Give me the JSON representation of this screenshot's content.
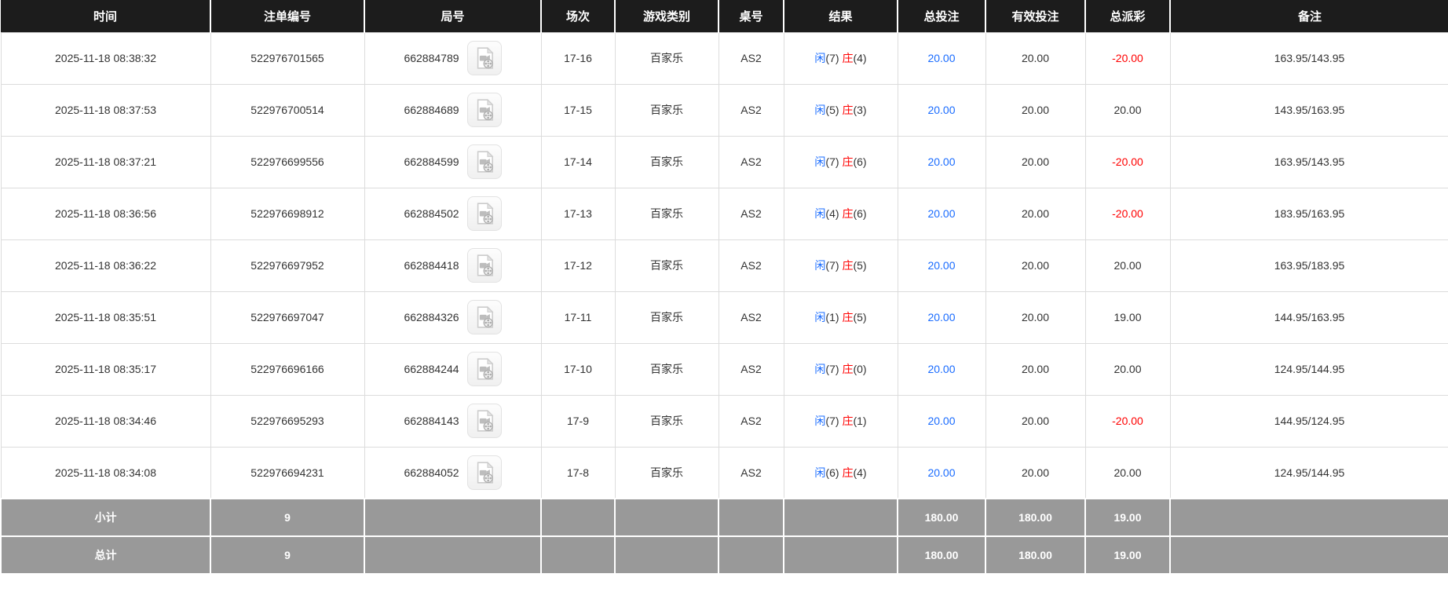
{
  "colors": {
    "header_bg": "#1c1c1c",
    "accent_blue": "#1a6cff",
    "negative_red": "#ff0000",
    "summary_bg": "#999999",
    "grid_line": "#dcdcdc"
  },
  "icons": {
    "video_replay": "video-replay-icon"
  },
  "table": {
    "columns": [
      "时间",
      "注单编号",
      "局号",
      "场次",
      "游戏类别",
      "桌号",
      "结果",
      "总投注",
      "有效投注",
      "总派彩",
      "备注"
    ],
    "rows": [
      {
        "time": "2025-11-18 08:38:32",
        "bet_no": "522976701565",
        "round_no": "662884789",
        "session": "17-16",
        "game": "百家乐",
        "table": "AS2",
        "p": "闲",
        "ps": "(7)",
        "b": "庄",
        "bs": "(4)",
        "total": "20.00",
        "valid": "20.00",
        "payout": "-20.00",
        "remark": "163.95/143.95"
      },
      {
        "time": "2025-11-18 08:37:53",
        "bet_no": "522976700514",
        "round_no": "662884689",
        "session": "17-15",
        "game": "百家乐",
        "table": "AS2",
        "p": "闲",
        "ps": "(5)",
        "b": "庄",
        "bs": "(3)",
        "total": "20.00",
        "valid": "20.00",
        "payout": "20.00",
        "remark": "143.95/163.95"
      },
      {
        "time": "2025-11-18 08:37:21",
        "bet_no": "522976699556",
        "round_no": "662884599",
        "session": "17-14",
        "game": "百家乐",
        "table": "AS2",
        "p": "闲",
        "ps": "(7)",
        "b": "庄",
        "bs": "(6)",
        "total": "20.00",
        "valid": "20.00",
        "payout": "-20.00",
        "remark": "163.95/143.95"
      },
      {
        "time": "2025-11-18 08:36:56",
        "bet_no": "522976698912",
        "round_no": "662884502",
        "session": "17-13",
        "game": "百家乐",
        "table": "AS2",
        "p": "闲",
        "ps": "(4)",
        "b": "庄",
        "bs": "(6)",
        "total": "20.00",
        "valid": "20.00",
        "payout": "-20.00",
        "remark": "183.95/163.95"
      },
      {
        "time": "2025-11-18 08:36:22",
        "bet_no": "522976697952",
        "round_no": "662884418",
        "session": "17-12",
        "game": "百家乐",
        "table": "AS2",
        "p": "闲",
        "ps": "(7)",
        "b": "庄",
        "bs": "(5)",
        "total": "20.00",
        "valid": "20.00",
        "payout": "20.00",
        "remark": "163.95/183.95"
      },
      {
        "time": "2025-11-18 08:35:51",
        "bet_no": "522976697047",
        "round_no": "662884326",
        "session": "17-11",
        "game": "百家乐",
        "table": "AS2",
        "p": "闲",
        "ps": "(1)",
        "b": "庄",
        "bs": "(5)",
        "total": "20.00",
        "valid": "20.00",
        "payout": "19.00",
        "remark": "144.95/163.95"
      },
      {
        "time": "2025-11-18 08:35:17",
        "bet_no": "522976696166",
        "round_no": "662884244",
        "session": "17-10",
        "game": "百家乐",
        "table": "AS2",
        "p": "闲",
        "ps": "(7)",
        "b": "庄",
        "bs": "(0)",
        "total": "20.00",
        "valid": "20.00",
        "payout": "20.00",
        "remark": "124.95/144.95"
      },
      {
        "time": "2025-11-18 08:34:46",
        "bet_no": "522976695293",
        "round_no": "662884143",
        "session": "17-9",
        "game": "百家乐",
        "table": "AS2",
        "p": "闲",
        "ps": "(7)",
        "b": "庄",
        "bs": "(1)",
        "total": "20.00",
        "valid": "20.00",
        "payout": "-20.00",
        "remark": "144.95/124.95"
      },
      {
        "time": "2025-11-18 08:34:08",
        "bet_no": "522976694231",
        "round_no": "662884052",
        "session": "17-8",
        "game": "百家乐",
        "table": "AS2",
        "p": "闲",
        "ps": "(6)",
        "b": "庄",
        "bs": "(4)",
        "total": "20.00",
        "valid": "20.00",
        "payout": "20.00",
        "remark": "124.95/144.95"
      }
    ],
    "summary": [
      {
        "label": "小计",
        "count": "9",
        "total": "180.00",
        "valid": "180.00",
        "payout": "19.00"
      },
      {
        "label": "总计",
        "count": "9",
        "total": "180.00",
        "valid": "180.00",
        "payout": "19.00"
      }
    ]
  }
}
